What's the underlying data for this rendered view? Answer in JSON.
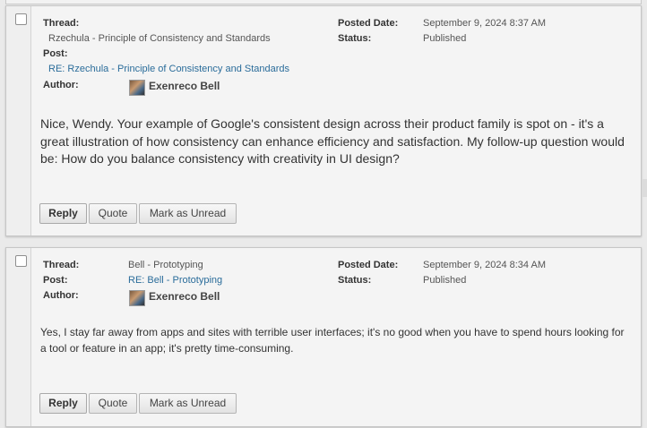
{
  "posts": [
    {
      "thread_label": "Thread:",
      "thread": "Rzechula - Principle of Consistency and Standards",
      "post_label": "Post:",
      "post": "RE: Rzechula - Principle of Consistency and Standards",
      "author_label": "Author:",
      "author": "Exenreco Bell",
      "date_label": "Posted Date:",
      "date": "September 9, 2024 8:37 AM",
      "status_label": "Status:",
      "status": "Published",
      "body": "Nice, Wendy. Your example of Google's consistent design across their product family is spot on - it's a great illustration of how consistency can enhance efficiency and satisfaction. My follow-up question would be: How do you balance consistency with creativity in UI design?",
      "reply": "Reply",
      "quote": "Quote",
      "mark_unread": "Mark as Unread"
    },
    {
      "thread_label": "Thread:",
      "thread": "Bell - Prototyping",
      "post_label": "Post:",
      "post": "RE: Bell - Prototyping",
      "author_label": "Author:",
      "author": "Exenreco Bell",
      "date_label": "Posted Date:",
      "date": "September 9, 2024 8:34 AM",
      "status_label": "Status:",
      "status": "Published",
      "body": "Yes, I stay far away from apps and sites with terrible user interfaces; it's no good when you have to spend hours looking for a tool or feature in an app; it's pretty time-consuming.",
      "reply": "Reply",
      "quote": "Quote",
      "mark_unread": "Mark as Unread"
    }
  ]
}
